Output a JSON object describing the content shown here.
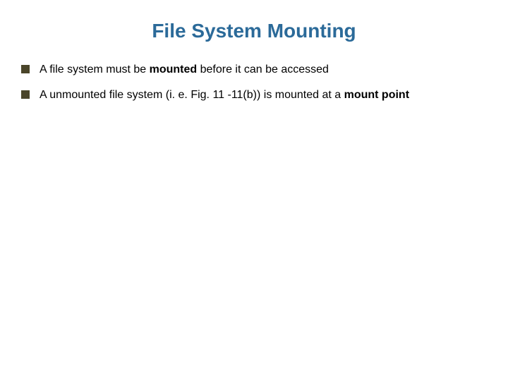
{
  "title": "File System Mounting",
  "bullets": [
    {
      "pre": "A file system must be ",
      "bold1": "mounted",
      "mid": " before it can be accessed",
      "bold2": "",
      "post": ""
    },
    {
      "pre": "A unmounted file system (i. e. Fig. 11 -11(b)) is mounted at a ",
      "bold1": "mount point",
      "mid": "",
      "bold2": "",
      "post": ""
    }
  ]
}
